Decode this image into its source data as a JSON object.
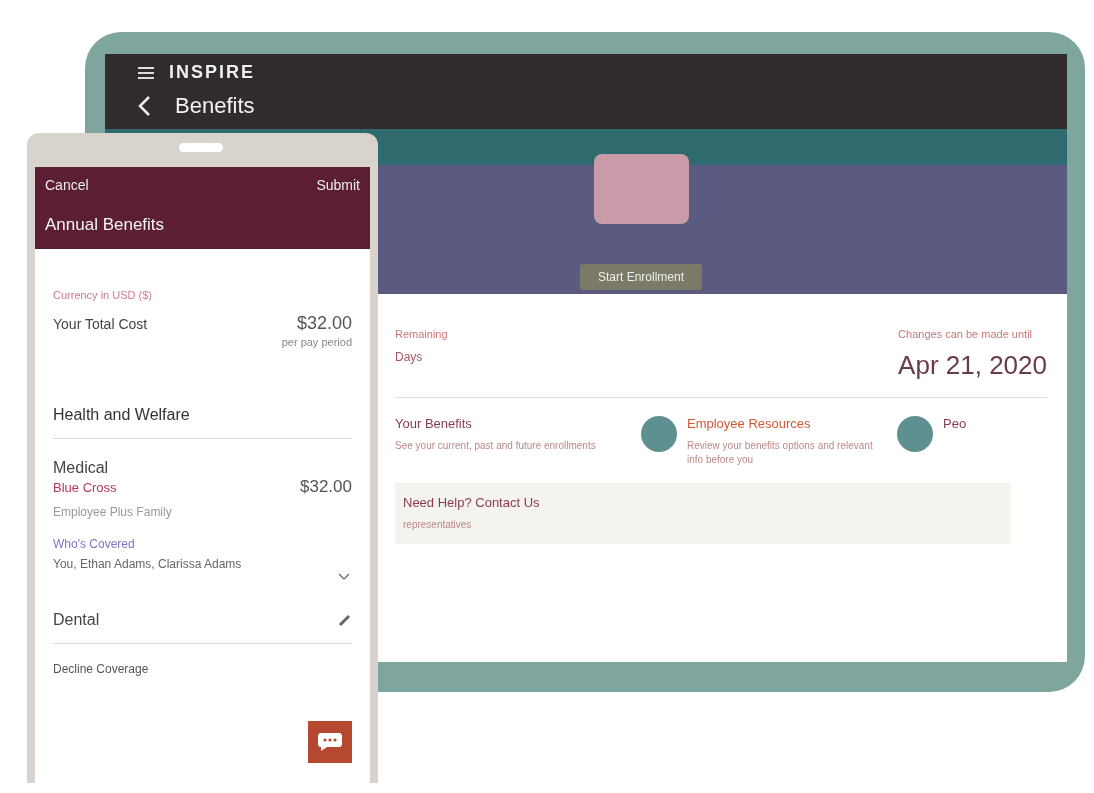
{
  "tablet": {
    "brand": "INSPIRE",
    "title": "Benefits",
    "hero_button": "Start Enrollment",
    "remaining": {
      "label": "Remaining",
      "value": "Days"
    },
    "deadline": {
      "label": "Changes can be made until",
      "value": "Apr 21, 2020"
    },
    "cards": [
      {
        "title": "Your Benefits",
        "text": "See your current, past and future enrollments"
      },
      {
        "title": "Employee Resources",
        "text": "Review your benefits options and relevant info before you"
      },
      {
        "title": "Peo"
      }
    ],
    "help": {
      "title": "Need Help? Contact Us",
      "text": "representatives"
    }
  },
  "phone": {
    "cancel": "Cancel",
    "submit": "Submit",
    "title": "Annual Benefits",
    "currency": "Currency in USD ($)",
    "total": {
      "label": "Your Total Cost",
      "amount": "$32.00",
      "period": "per pay period"
    },
    "section": "Health and Welfare",
    "plans": [
      {
        "name": "Medical",
        "provider": "Blue Cross",
        "amount": "$32.00",
        "option": "Employee Plus Family",
        "covered_label": "Who's Covered",
        "covered": "You, Ethan Adams, Clarissa Adams",
        "kind": "detailed"
      },
      {
        "name": "Dental",
        "option": "Decline Coverage",
        "kind": "summary"
      }
    ]
  }
}
